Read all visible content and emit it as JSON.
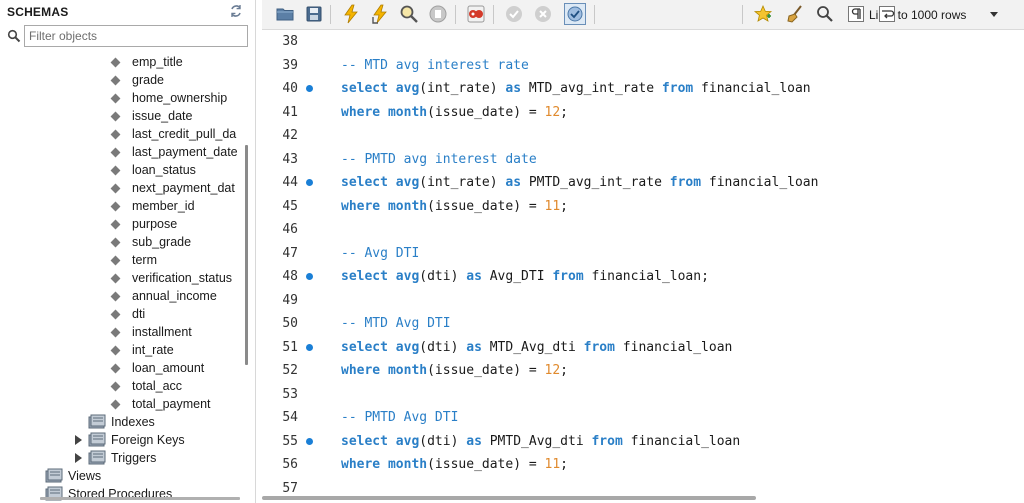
{
  "schemas": {
    "title": "SCHEMAS",
    "filter_placeholder": "Filter objects",
    "columns": [
      "emp_title",
      "grade",
      "home_ownership",
      "issue_date",
      "last_credit_pull_da",
      "last_payment_date",
      "loan_status",
      "next_payment_dat",
      "member_id",
      "purpose",
      "sub_grade",
      "term",
      "verification_status",
      "annual_income",
      "dti",
      "installment",
      "int_rate",
      "loan_amount",
      "total_acc",
      "total_payment"
    ],
    "nodes": {
      "indexes": "Indexes",
      "foreign_keys": "Foreign Keys",
      "triggers": "Triggers",
      "views": "Views",
      "stored_procedures": "Stored Procedures"
    }
  },
  "toolbar": {
    "limit_label": "Limit to 1000 rows"
  },
  "editor": {
    "lines": [
      {
        "n": "38",
        "dot": false,
        "tokens": []
      },
      {
        "n": "39",
        "dot": false,
        "tokens": [
          {
            "t": "-- MTD avg interest rate",
            "c": "cmt"
          }
        ]
      },
      {
        "n": "40",
        "dot": true,
        "tokens": [
          {
            "t": "select",
            "c": "kw"
          },
          {
            "t": " ",
            "c": "plain"
          },
          {
            "t": "avg",
            "c": "fn"
          },
          {
            "t": "(int_rate) ",
            "c": "plain"
          },
          {
            "t": "as",
            "c": "kw"
          },
          {
            "t": " MTD_avg_int_rate ",
            "c": "plain"
          },
          {
            "t": "from",
            "c": "kw"
          },
          {
            "t": " financial_loan",
            "c": "plain"
          }
        ]
      },
      {
        "n": "41",
        "dot": false,
        "tokens": [
          {
            "t": "where",
            "c": "kw"
          },
          {
            "t": " ",
            "c": "plain"
          },
          {
            "t": "month",
            "c": "fn"
          },
          {
            "t": "(issue_date) = ",
            "c": "plain"
          },
          {
            "t": "12",
            "c": "numl"
          },
          {
            "t": ";",
            "c": "plain"
          }
        ]
      },
      {
        "n": "42",
        "dot": false,
        "tokens": []
      },
      {
        "n": "43",
        "dot": false,
        "tokens": [
          {
            "t": "-- PMTD avg interest date",
            "c": "cmt"
          }
        ]
      },
      {
        "n": "44",
        "dot": true,
        "tokens": [
          {
            "t": "select",
            "c": "kw"
          },
          {
            "t": " ",
            "c": "plain"
          },
          {
            "t": "avg",
            "c": "fn"
          },
          {
            "t": "(int_rate) ",
            "c": "plain"
          },
          {
            "t": "as",
            "c": "kw"
          },
          {
            "t": " PMTD_avg_int_rate ",
            "c": "plain"
          },
          {
            "t": "from",
            "c": "kw"
          },
          {
            "t": " financial_loan",
            "c": "plain"
          }
        ]
      },
      {
        "n": "45",
        "dot": false,
        "tokens": [
          {
            "t": "where",
            "c": "kw"
          },
          {
            "t": " ",
            "c": "plain"
          },
          {
            "t": "month",
            "c": "fn"
          },
          {
            "t": "(issue_date) = ",
            "c": "plain"
          },
          {
            "t": "11",
            "c": "numl"
          },
          {
            "t": ";",
            "c": "plain"
          }
        ]
      },
      {
        "n": "46",
        "dot": false,
        "tokens": []
      },
      {
        "n": "47",
        "dot": false,
        "tokens": [
          {
            "t": "-- Avg DTI",
            "c": "cmt"
          }
        ]
      },
      {
        "n": "48",
        "dot": true,
        "tokens": [
          {
            "t": "select",
            "c": "kw"
          },
          {
            "t": " ",
            "c": "plain"
          },
          {
            "t": "avg",
            "c": "fn"
          },
          {
            "t": "(dti) ",
            "c": "plain"
          },
          {
            "t": "as",
            "c": "kw"
          },
          {
            "t": " Avg_DTI ",
            "c": "plain"
          },
          {
            "t": "from",
            "c": "kw"
          },
          {
            "t": " financial_loan;",
            "c": "plain"
          }
        ]
      },
      {
        "n": "49",
        "dot": false,
        "tokens": []
      },
      {
        "n": "50",
        "dot": false,
        "tokens": [
          {
            "t": "-- MTD Avg DTI",
            "c": "cmt"
          }
        ]
      },
      {
        "n": "51",
        "dot": true,
        "tokens": [
          {
            "t": "select",
            "c": "kw"
          },
          {
            "t": " ",
            "c": "plain"
          },
          {
            "t": "avg",
            "c": "fn"
          },
          {
            "t": "(dti) ",
            "c": "plain"
          },
          {
            "t": "as",
            "c": "kw"
          },
          {
            "t": " MTD_Avg_dti ",
            "c": "plain"
          },
          {
            "t": "from",
            "c": "kw"
          },
          {
            "t": " financial_loan",
            "c": "plain"
          }
        ]
      },
      {
        "n": "52",
        "dot": false,
        "tokens": [
          {
            "t": "where",
            "c": "kw"
          },
          {
            "t": " ",
            "c": "plain"
          },
          {
            "t": "month",
            "c": "fn"
          },
          {
            "t": "(issue_date) = ",
            "c": "plain"
          },
          {
            "t": "12",
            "c": "numl"
          },
          {
            "t": ";",
            "c": "plain"
          }
        ]
      },
      {
        "n": "53",
        "dot": false,
        "tokens": []
      },
      {
        "n": "54",
        "dot": false,
        "tokens": [
          {
            "t": "-- PMTD Avg DTI",
            "c": "cmt"
          }
        ]
      },
      {
        "n": "55",
        "dot": true,
        "tokens": [
          {
            "t": "select",
            "c": "kw"
          },
          {
            "t": " ",
            "c": "plain"
          },
          {
            "t": "avg",
            "c": "fn"
          },
          {
            "t": "(dti) ",
            "c": "plain"
          },
          {
            "t": "as",
            "c": "kw"
          },
          {
            "t": " PMTD_Avg_dti ",
            "c": "plain"
          },
          {
            "t": "from",
            "c": "kw"
          },
          {
            "t": " financial_loan",
            "c": "plain"
          }
        ]
      },
      {
        "n": "56",
        "dot": false,
        "tokens": [
          {
            "t": "where",
            "c": "kw"
          },
          {
            "t": " ",
            "c": "plain"
          },
          {
            "t": "month",
            "c": "fn"
          },
          {
            "t": "(issue_date) = ",
            "c": "plain"
          },
          {
            "t": "11",
            "c": "numl"
          },
          {
            "t": ";",
            "c": "plain"
          }
        ]
      },
      {
        "n": "57",
        "dot": false,
        "tokens": []
      }
    ]
  },
  "colors": {
    "keyword": "#2a7fc7",
    "number": "#e08a2d",
    "breakpoint_dot": "#1a7fd6"
  },
  "icons": [
    "open-folder-icon",
    "save-icon",
    "execute-lightning-icon",
    "execute-cursor-icon",
    "explain-magnifier-icon",
    "stop-icon",
    "toggle-error-icon",
    "commit-icon",
    "rollback-icon",
    "autocommit-icon",
    "favorite-star-icon",
    "beautify-broom-icon",
    "find-icon",
    "invisible-chars-icon",
    "wrap-icon"
  ]
}
